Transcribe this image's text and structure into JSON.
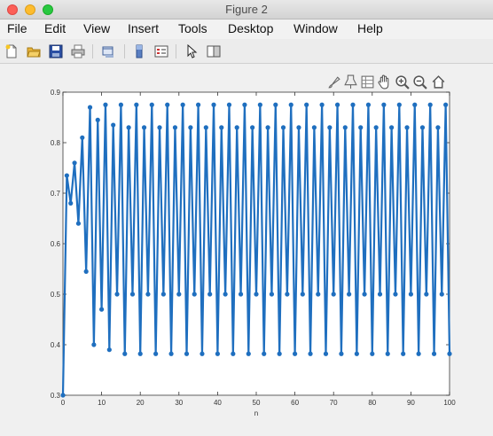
{
  "window": {
    "title": "Figure 2"
  },
  "menu": {
    "items": [
      "File",
      "Edit",
      "View",
      "Insert",
      "Tools",
      "Desktop",
      "Window",
      "Help"
    ]
  },
  "toolbar": {
    "icons": [
      "new-figure-icon",
      "open-file-icon",
      "save-icon",
      "print-icon",
      "link-plot-icon",
      "colorbar-icon",
      "legend-icon",
      "edit-plot-icon",
      "property-editor-icon"
    ]
  },
  "axes_toolbar": {
    "icons": [
      "brush-icon",
      "data-tip-icon",
      "rotate-icon",
      "pan-icon",
      "zoom-in-icon",
      "zoom-out-icon",
      "home-icon"
    ]
  },
  "colors": {
    "series": "#1f6fbf"
  },
  "chart_data": {
    "type": "line",
    "xlabel": "n",
    "ylabel": "",
    "xlim": [
      0,
      100
    ],
    "ylim": [
      0.3,
      0.9
    ],
    "xticks": [
      0,
      10,
      20,
      30,
      40,
      50,
      60,
      70,
      80,
      90,
      100
    ],
    "yticks": [
      0.3,
      0.4,
      0.5,
      0.6,
      0.7,
      0.8,
      0.9
    ],
    "xtick_labels": [
      "0",
      "10",
      "20",
      "30",
      "40",
      "50",
      "60",
      "70",
      "80",
      "90",
      "100"
    ],
    "ytick_labels": [
      "0.3",
      "0.4",
      "0.5",
      "0.6",
      "0.7",
      "0.8",
      "0.9"
    ],
    "series": [
      {
        "marker": "dot",
        "x": [
          0,
          1,
          2,
          3,
          4,
          5,
          6,
          7,
          8,
          9,
          10,
          11,
          12,
          13,
          14,
          15,
          16,
          17,
          18,
          19,
          20,
          21,
          22,
          23,
          24,
          25,
          26,
          27,
          28,
          29,
          30,
          31,
          32,
          33,
          34,
          35,
          36,
          37,
          38,
          39,
          40,
          41,
          42,
          43,
          44,
          45,
          46,
          47,
          48,
          49,
          50,
          51,
          52,
          53,
          54,
          55,
          56,
          57,
          58,
          59,
          60,
          61,
          62,
          63,
          64,
          65,
          66,
          67,
          68,
          69,
          70,
          71,
          72,
          73,
          74,
          75,
          76,
          77,
          78,
          79,
          80,
          81,
          82,
          83,
          84,
          85,
          86,
          87,
          88,
          89,
          90,
          91,
          92,
          93,
          94,
          95,
          96,
          97,
          98,
          99,
          100
        ],
        "values": [
          0.3,
          0.735,
          0.68,
          0.76,
          0.64,
          0.81,
          0.545,
          0.87,
          0.4,
          0.845,
          0.47,
          0.875,
          0.39,
          0.835,
          0.5,
          0.875,
          0.382,
          0.83,
          0.5,
          0.875,
          0.382,
          0.83,
          0.5,
          0.875,
          0.382,
          0.83,
          0.5,
          0.875,
          0.382,
          0.83,
          0.5,
          0.875,
          0.382,
          0.83,
          0.5,
          0.875,
          0.382,
          0.83,
          0.5,
          0.875,
          0.382,
          0.83,
          0.5,
          0.875,
          0.382,
          0.83,
          0.5,
          0.875,
          0.382,
          0.83,
          0.5,
          0.875,
          0.382,
          0.83,
          0.5,
          0.875,
          0.382,
          0.83,
          0.5,
          0.875,
          0.382,
          0.83,
          0.5,
          0.875,
          0.382,
          0.83,
          0.5,
          0.875,
          0.382,
          0.83,
          0.5,
          0.875,
          0.382,
          0.83,
          0.5,
          0.875,
          0.382,
          0.83,
          0.5,
          0.875,
          0.382,
          0.83,
          0.5,
          0.875,
          0.382,
          0.83,
          0.5,
          0.875,
          0.382,
          0.83,
          0.5,
          0.875,
          0.382,
          0.83,
          0.5,
          0.875,
          0.382,
          0.83,
          0.5,
          0.875,
          0.382
        ]
      }
    ]
  }
}
